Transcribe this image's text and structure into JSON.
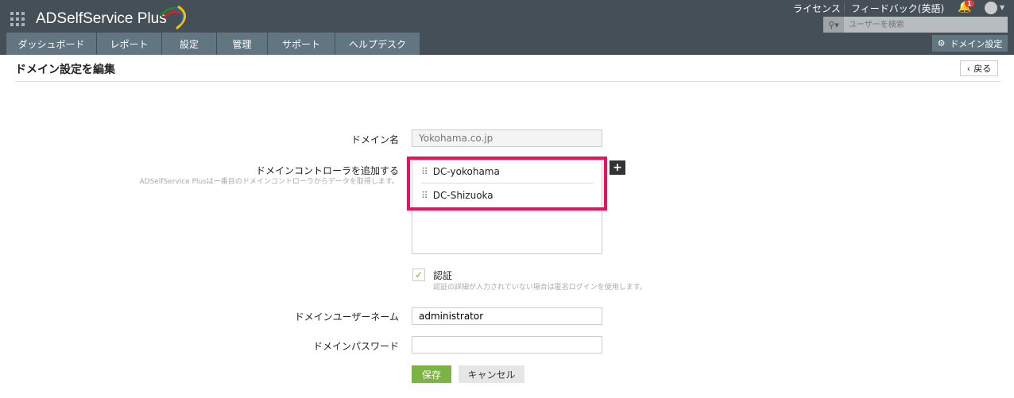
{
  "header": {
    "app_name": "ADSelfService Plus",
    "license": "ライセンス",
    "feedback": "フィードバック(英語)",
    "notification_count": "1",
    "search_placeholder": "ユーザーを検索",
    "domain_settings": "ドメイン設定"
  },
  "tabs": [
    {
      "label": "ダッシュボード"
    },
    {
      "label": "レポート"
    },
    {
      "label": "設定"
    },
    {
      "label": "管理"
    },
    {
      "label": "サポート"
    },
    {
      "label": "ヘルプデスク"
    }
  ],
  "page": {
    "title": "ドメイン設定を編集",
    "back": "戻る"
  },
  "form": {
    "domain_name_label": "ドメイン名",
    "domain_name_value": "Yokohama.co.jp",
    "dc_label": "ドメインコントローラを追加する",
    "dc_hint": "ADSelfService Plusは一番目のドメインコントローラからデータを取得します。",
    "dcs": [
      "DC-yokohama",
      "DC-Shizuoka"
    ],
    "auth_label": "認証",
    "auth_hint": "認証の詳細が入力されていない場合は匿名ログインを使用します。",
    "auth_checked": true,
    "username_label": "ドメインユーザーネーム",
    "username_value": "administrator",
    "password_label": "ドメインパスワード",
    "password_value": "",
    "save": "保存",
    "cancel": "キャンセル"
  },
  "colors": {
    "header": "#444f58",
    "tab": "#627681",
    "highlight": "#f0105a",
    "save": "#7cb342"
  }
}
